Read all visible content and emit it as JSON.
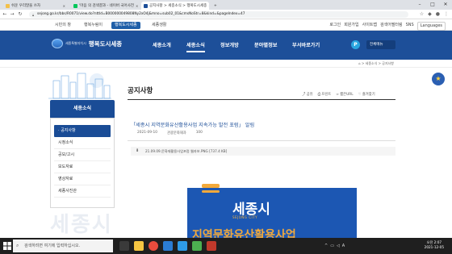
{
  "browser": {
    "tabs": [
      {
        "label": "쉬운 우리말을 쓰자"
      },
      {
        "label": "'마음 의 검색결과 - 네이버 국어사전"
      },
      {
        "label": "공지사항 > 세종소식 > 행복도시세종"
      },
      {
        "label": ""
      }
    ],
    "url": "sejong.go.kr/bbs/R0071/view.do?nttId=B000000049808Ny2xO4j&mno=sub02_01&cmsNoStr=8&kind=&pageIndex=47",
    "window_controls": [
      "–",
      "□",
      "✕"
    ]
  },
  "util": {
    "links": [
      "시민의 창",
      "행복누림이",
      "행복도시세종",
      "세종생활"
    ],
    "right": [
      "로그인",
      "회원가입",
      "사이트맵",
      "검색어필터링",
      "SNS",
      "Languages"
    ]
  },
  "gnb": {
    "logo_small": "세종특별자치시",
    "logo": "행복도시세종",
    "menus": [
      "세종소개",
      "세종소식",
      "정보개방",
      "분야별정보",
      "부서바로가기"
    ],
    "all_menu": "전체메뉴"
  },
  "breadcrumb": "⌂ > 세종소식 > 공지사항",
  "lnb": {
    "title": "세종소식",
    "items": [
      "공지사항",
      "시정소식",
      "공모/고시",
      "보도자료",
      "영상자료",
      "세종사진관"
    ],
    "watermark": "세종시"
  },
  "content": {
    "title": "공지사항",
    "tools": [
      "공유",
      "프린트",
      "짧은URL",
      "즐겨찾기"
    ],
    "article_title": "「세종시 지역문화유산활용사업 지속가능 발전 포럼」 알림",
    "meta": [
      "2021-09-10",
      "관광문화재과",
      "100"
    ],
    "attachment": "21.09.09.문화재활용사업포럼 웹자보.PNG [737.4 KB]",
    "poster_logo": "세종시",
    "poster_sub": "SEJONG CITY",
    "poster_text": "지역문화유산활용사업"
  },
  "taskbar": {
    "search_placeholder": "검색하려면 여기에 입력하십시오.",
    "time": "오전 2:07",
    "date": "2021-12-05",
    "lang": "A"
  }
}
